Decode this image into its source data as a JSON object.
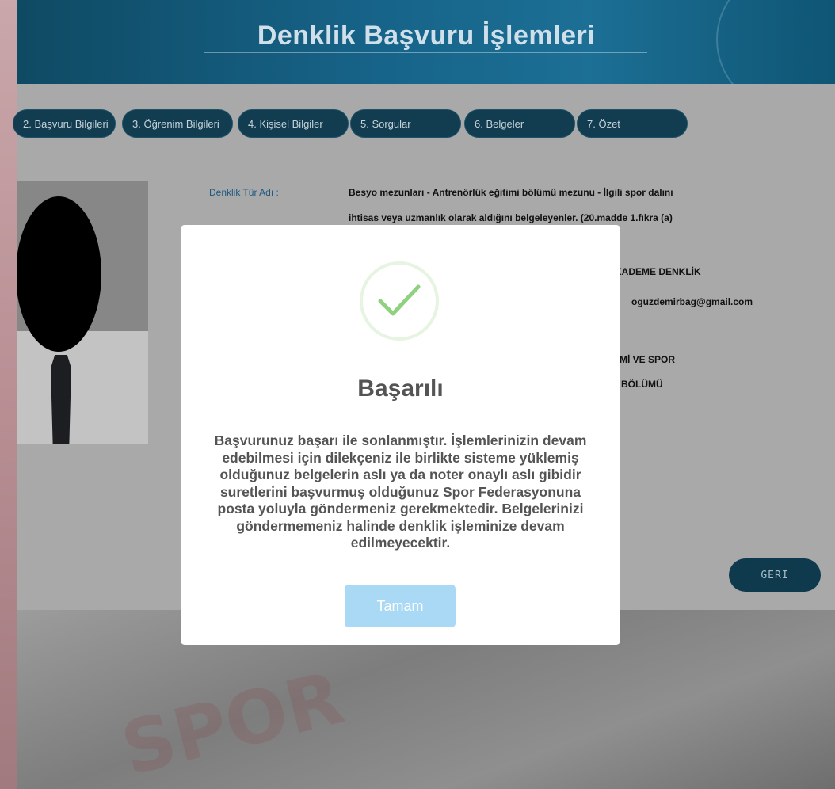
{
  "header": {
    "title": "Denklik Başvuru İşlemleri"
  },
  "tabs": [
    {
      "label": "2. Başvuru Bilgileri"
    },
    {
      "label": "3. Öğrenim Bilgileri"
    },
    {
      "label": "4. Kişisel Bilgiler"
    },
    {
      "label": "5. Sorgular"
    },
    {
      "label": "6. Belgeler"
    },
    {
      "label": "7. Özet"
    }
  ],
  "info": {
    "type_label": "Denklik Tür Adı :",
    "type_line1": "Besyo mezunları - Antrenörlük eğitimi bölümü mezunu - İlgili spor dalını",
    "type_line2": "ihtisas veya uzmanlık olarak aldığını belgeleyenler. (20.madde 1.fıkra (a)",
    "level_partial": "KADEME DENKLİK",
    "email": "oguzdemirbag@gmail.com",
    "school_partial1": "Mİ VE SPOR",
    "school_partial2": "BÖLÜMÜ"
  },
  "back_button": {
    "label": "GERI"
  },
  "modal": {
    "title": "Başarılı",
    "lines": [
      "Başvurunuz başarı ile sonlanmıştır. İşlemlerinizin devam",
      "edebilmesi için dilekçeniz ile birlikte sisteme yüklemiş",
      "olduğunuz belgelerin aslı ya da noter onaylı aslı gibidir",
      "suretlerini başvurmuş olduğunuz Spor Federasyonuna",
      "posta yoluyla göndermeniz gerekmektedir. Belgelerinizi",
      "göndermemeniz halinde denklik işleminize devam",
      "edilmeyecektir."
    ],
    "ok_label": "Tamam"
  },
  "watermark": {
    "text": "SPOR"
  },
  "colors": {
    "header": "#17648a",
    "tab": "#123c4f",
    "success": "#7dcb6b",
    "ok_button": "#a9d9f4"
  }
}
